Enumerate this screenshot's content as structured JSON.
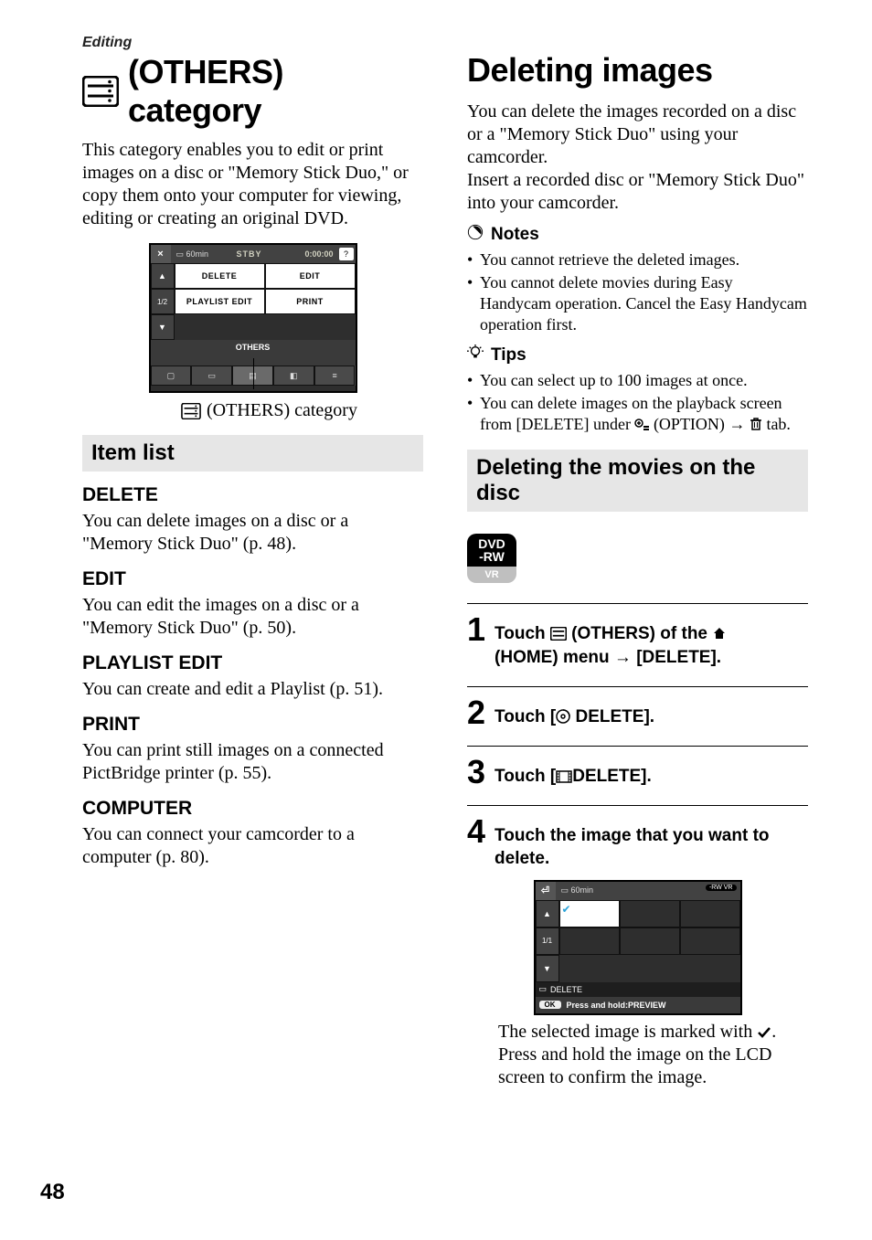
{
  "left": {
    "breadcrumb": "Editing",
    "title": "(OTHERS) category",
    "intro": "This category enables you to edit or print images on a disc or \"Memory Stick Duo,\" or copy them onto your computer for viewing, editing or creating an original DVD.",
    "mock": {
      "batt": "60min",
      "stby": "STBY",
      "time": "0:00:00",
      "help": "?",
      "close": "×",
      "pager": "1/2",
      "btn_delete": "DELETE",
      "btn_edit": "EDIT",
      "btn_playlist": "PLAYLIST EDIT",
      "btn_print": "PRINT",
      "row_label": "OTHERS"
    },
    "caption": "(OTHERS) category",
    "itemlist_heading": "Item list",
    "items": {
      "delete_h": "DELETE",
      "delete_b": "You can delete images on a disc or a \"Memory Stick Duo\" (p. 48).",
      "edit_h": "EDIT",
      "edit_b": "You can edit the images on a disc or a \"Memory Stick Duo\" (p. 50).",
      "playlist_h": "PLAYLIST EDIT",
      "playlist_b": "You can create and edit a Playlist (p. 51).",
      "print_h": "PRINT",
      "print_b": "You can print still images on a connected PictBridge printer (p. 55).",
      "computer_h": "COMPUTER",
      "computer_b": "You can connect your camcorder to a computer (p. 80)."
    }
  },
  "right": {
    "title": "Deleting images",
    "intro1": "You can delete the images recorded on a disc or a \"Memory Stick Duo\" using your camcorder.",
    "intro2": "Insert a recorded disc or \"Memory Stick Duo\" into your camcorder.",
    "notes_label": "Notes",
    "notes": [
      "You cannot retrieve the deleted images.",
      "You cannot delete movies during Easy Handycam operation. Cancel the Easy Handycam operation first."
    ],
    "tips_label": "Tips",
    "tips_1": "You can select up to 100 images at once.",
    "tips_2a": "You can delete images on the playback screen from [DELETE] under ",
    "tips_2b": " (OPTION) ",
    "tips_2c": " tab.",
    "section_heading": "Deleting the movies on the disc",
    "badge_top": "DVD\n-RW",
    "badge_bottom": "VR",
    "steps": {
      "s1a": "Touch ",
      "s1b": " (OTHERS) of the ",
      "s1c": "(HOME) menu → [DELETE].",
      "s2a": "Touch [",
      "s2b": " DELETE].",
      "s3a": "Touch [",
      "s3b": "DELETE].",
      "s4": "Touch the image that you want to delete."
    },
    "mock2": {
      "back": "⏎",
      "batt": "60min",
      "rw": "-RW VR",
      "pager": "1/1",
      "del_label": "DELETE",
      "ok": "OK",
      "hint": "Press and hold:PREVIEW"
    },
    "after1": "The selected image is marked with ",
    "after2": ".",
    "after3": "Press and hold the image on the LCD screen to confirm the image."
  },
  "page_number": "48"
}
